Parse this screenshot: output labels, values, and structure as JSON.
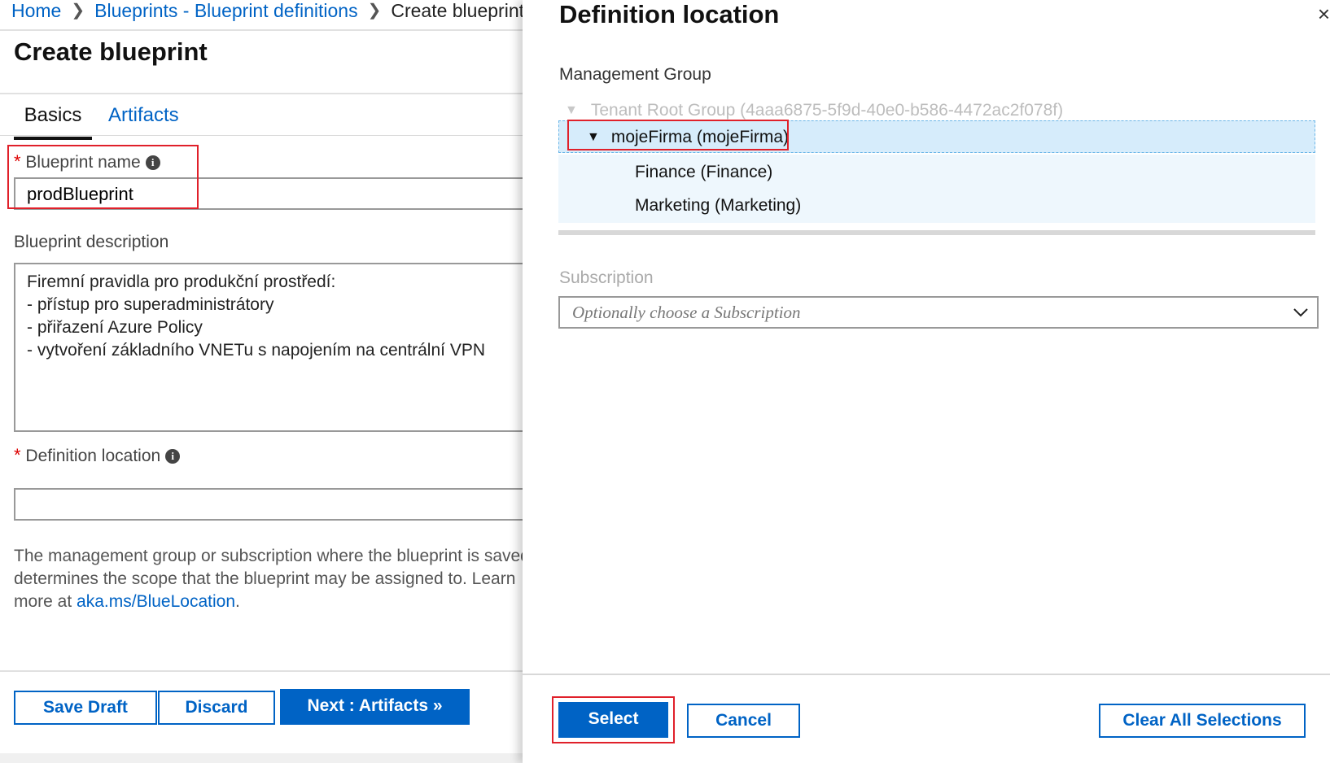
{
  "breadcrumb": {
    "home": "Home",
    "blueprints": "Blueprints - Blueprint definitions",
    "current": "Create blueprint"
  },
  "page": {
    "title": "Create blueprint"
  },
  "tabs": [
    {
      "label": "Basics",
      "active": true
    },
    {
      "label": "Artifacts",
      "active": false
    }
  ],
  "form": {
    "required_mark": "*",
    "name_label": "Blueprint name",
    "name_value": "prodBlueprint",
    "description_label": "Blueprint description",
    "description_value": "Firemní pravidla pro produkční prostředí:\n- přístup pro superadministrátory\n- přiřazení Azure Policy\n- vytvoření základního VNETu s napojením na centrální VPN",
    "location_label": "Definition location",
    "location_value": "",
    "help_text": "The management group or subscription where the blueprint is saved determines the scope that the blueprint may be assigned to. Learn more at",
    "help_link": "aka.ms/BlueLocation",
    "help_suffix": "."
  },
  "left_buttons": {
    "save_draft": "Save Draft",
    "discard": "Discard",
    "next": "Next : Artifacts »"
  },
  "panel": {
    "title": "Definition location",
    "management_group_label": "Management Group",
    "tree": {
      "root": "Tenant Root Group (4aaa6875-5f9d-40e0-b586-4472ac2f078f)",
      "selected": "mojeFirma (mojeFirma)",
      "children": [
        "Finance (Finance)",
        "Marketing (Marketing)"
      ]
    },
    "subscription_label": "Subscription",
    "subscription_placeholder": "Optionally choose a Subscription",
    "buttons": {
      "select": "Select",
      "cancel": "Cancel",
      "clear": "Clear All Selections"
    },
    "close": "×"
  },
  "colors": {
    "accent": "#0063c5",
    "highlight_box": "#e0202a",
    "selected_row": "#d6ecfb"
  }
}
